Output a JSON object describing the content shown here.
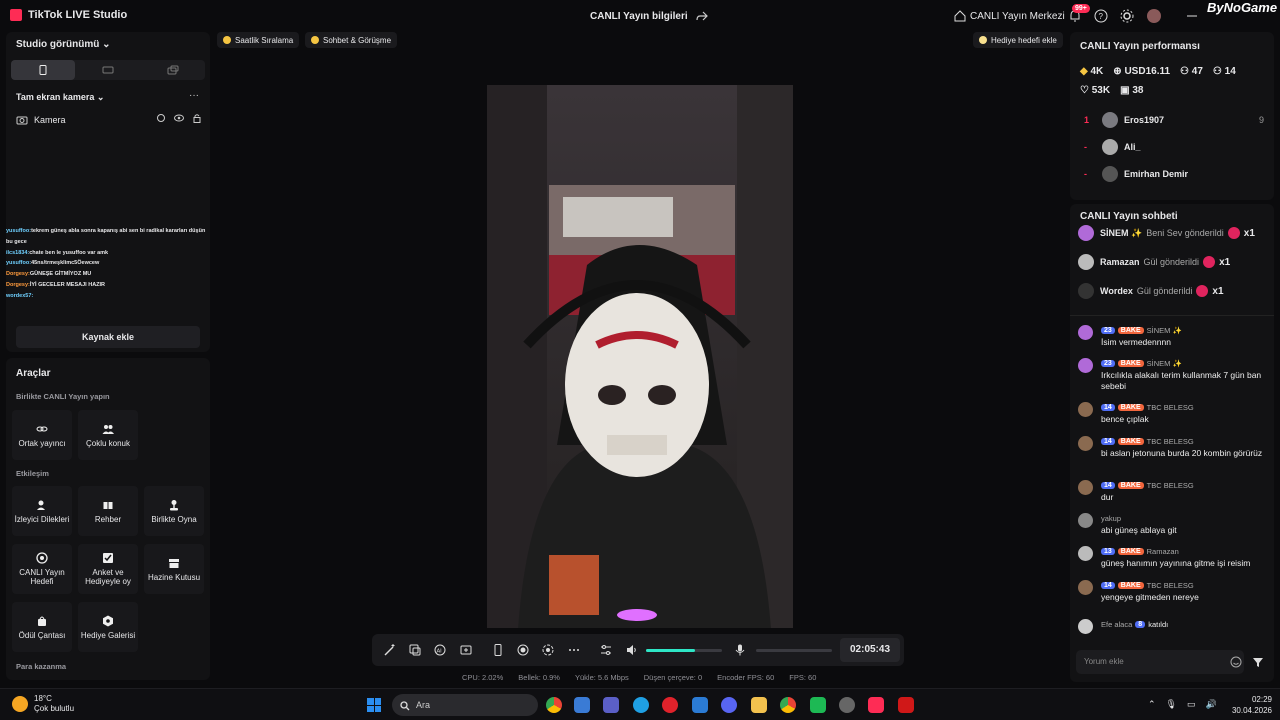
{
  "titlebar": {
    "app_name": "TikTok LIVE Studio",
    "live_info": "CANLI Yayın bilgileri",
    "live_center": "CANLI Yayın Merkezi",
    "notif_count": "99+",
    "watermark": "ByNoGame"
  },
  "left": {
    "studio_view": "Studio görünümü",
    "fullscreen_camera": "Tam ekran kamera",
    "camera_label": "Kamera",
    "add_source": "Kaynak ekle",
    "overlay_chat": [
      {
        "name": "yusuffoo:",
        "text": "tekrem güneş abla sonra kapanış abi sen bi radikal kararları düşün bu gece",
        "style": "nm"
      },
      {
        "name": "",
        "text": "",
        "style": "nm"
      },
      {
        "name": "ilcs1834:",
        "text": "chate ben le yusuffoo var amk",
        "style": "nm"
      },
      {
        "name": "yusuffoo:",
        "text": "45ns/trmeşklimc5Öewcew",
        "style": "nm"
      },
      {
        "name": "Dorgesy:",
        "text": "GÜNEŞE GİTMİYOZ MU",
        "style": "nm2"
      },
      {
        "name": "Dorgesy:",
        "text": "İYİ GECELER MESAJI HAZIR",
        "style": "nm2"
      },
      {
        "name": "wordex57:",
        "text": "",
        "style": "nm"
      }
    ],
    "tools_title": "Araçlar",
    "section_together": "Birlikte CANLI Yayın yapın",
    "section_interaction": "Etkileşim",
    "section_earn": "Para kazanma",
    "tools": {
      "co_host": "Ortak yayıncı",
      "multi_guest": "Çoklu konuk",
      "viewer_wishes": "İzleyici Dilekleri",
      "guide": "Rehber",
      "play_together": "Birlikte Oyna",
      "live_goal": "CANLI Yayın Hedefi",
      "poll": "Anket ve Hediyeyle oy",
      "treasure": "Hazine Kutusu",
      "reward_bag": "Ödül Çantası",
      "gift_gallery": "Hediye Galerisi"
    }
  },
  "center": {
    "hourly_rank": "Saatlik Sıralama",
    "chat_meet": "Sohbet & Görüşme",
    "gift_goal": "Hediye hedefi ekle",
    "timer": "02:05:43",
    "volume_level": 0.65,
    "stats": {
      "cpu": "CPU: 2.02%",
      "memory": "Bellek: 0.9%",
      "upload": "Yükle: 5.6 Mbps",
      "dropped": "Düşen çerçeve: 0",
      "encoder_fps": "Encoder FPS: 60",
      "fps": "FPS: 60"
    }
  },
  "right": {
    "perf_title": "CANLI Yayın performansı",
    "metrics": {
      "diamonds": "4K",
      "usd": "USD16.11",
      "viewers": "47",
      "followers": "14",
      "likes": "53K",
      "gifts": "38"
    },
    "ranking": [
      {
        "rank": "1",
        "name": "Eros1907",
        "score": "9"
      },
      {
        "rank": "-",
        "name": "Ali_",
        "score": ""
      },
      {
        "rank": "-",
        "name": "Emirhan Demir",
        "score": ""
      }
    ],
    "chat_title": "CANLI Yayın sohbeti",
    "gifts": [
      {
        "name": "SİNEM ✨",
        "text": "Beni Sev gönderildi",
        "count": "x1"
      },
      {
        "name": "Ramazan",
        "text": "Gül gönderildi",
        "count": "x1"
      },
      {
        "name": "Wordex",
        "text": "Gül gönderildi",
        "count": "x1"
      }
    ],
    "messages": [
      {
        "level": "23",
        "fan": "BAKE",
        "user": "SİNEM ✨",
        "text": "İsim vermedennnn"
      },
      {
        "level": "23",
        "fan": "BAKE",
        "user": "SİNEM ✨",
        "text": "Irkcılıkla alakalı terim kullanmak 7 gün ban sebebi"
      },
      {
        "level": "14",
        "fan": "BAKE",
        "user": "TBC BELESG",
        "text": "bence çıplak"
      },
      {
        "level": "14",
        "fan": "BAKE",
        "user": "TBC BELESG",
        "text": "bi aslan jetonuna burda 20 kombin görürüz"
      },
      {
        "level": "14",
        "fan": "BAKE",
        "user": "TBC BELESG",
        "text": "dur"
      },
      {
        "level": "",
        "fan": "",
        "user": "yakup",
        "text": "abi güneş ablaya git"
      },
      {
        "level": "13",
        "fan": "BAKE",
        "user": "Ramazan",
        "text": "güneş hanımın yayınına gitme işi reisim"
      },
      {
        "level": "14",
        "fan": "BAKE",
        "user": "TBC BELESG",
        "text": "yengeye gitmeden nereye"
      }
    ],
    "join": {
      "user": "Efe alaca",
      "level": "8",
      "text": "katıldı"
    },
    "comment_placeholder": "Yorum ekle"
  },
  "taskbar": {
    "temp": "18°C",
    "weather": "Çok bulutlu",
    "search": "Ara",
    "time": "02:29",
    "date": "30.04.2026"
  }
}
